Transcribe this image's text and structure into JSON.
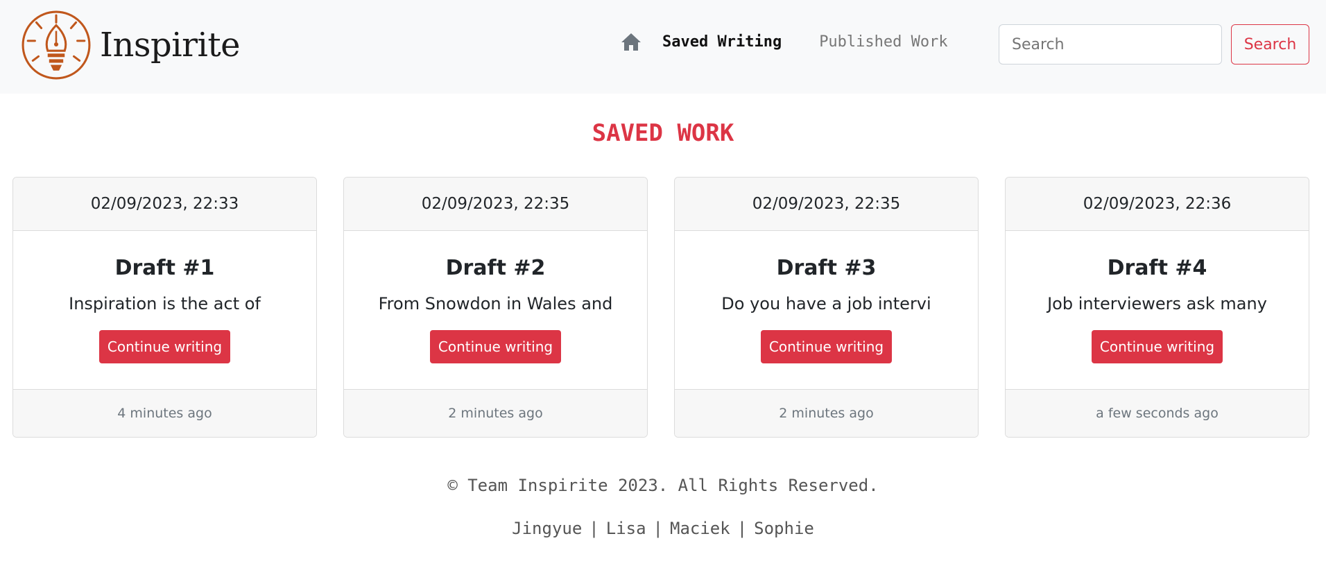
{
  "brand": {
    "name": "Inspirite",
    "logo_icon": "lightbulb-pen-nib-icon",
    "logo_color": "#c0571c"
  },
  "nav": {
    "home_icon": "home-icon",
    "links": [
      {
        "label": "Saved Writing",
        "active": true
      },
      {
        "label": "Published Work",
        "active": false
      }
    ]
  },
  "search": {
    "placeholder": "Search",
    "button_label": "Search"
  },
  "page": {
    "heading": "SAVED WORK",
    "accent": "#dc3545"
  },
  "drafts": [
    {
      "timestamp": "02/09/2023, 22:33",
      "title": "Draft #1",
      "excerpt": "Inspiration is the act of",
      "button_label": "Continue writing",
      "relative_time": "4 minutes ago"
    },
    {
      "timestamp": "02/09/2023, 22:35",
      "title": "Draft #2",
      "excerpt": "From Snowdon in Wales and",
      "button_label": "Continue writing",
      "relative_time": "2 minutes ago"
    },
    {
      "timestamp": "02/09/2023, 22:35",
      "title": "Draft #3",
      "excerpt": "Do you have a job intervi",
      "button_label": "Continue writing",
      "relative_time": "2 minutes ago"
    },
    {
      "timestamp": "02/09/2023, 22:36",
      "title": "Draft #4",
      "excerpt": "Job interviewers ask many",
      "button_label": "Continue writing",
      "relative_time": "a few seconds ago"
    }
  ],
  "footer": {
    "copyright": "© Team Inspirite 2023. All Rights Reserved.",
    "separator": "|",
    "names": [
      "Jingyue",
      "Lisa",
      "Maciek",
      "Sophie"
    ]
  }
}
